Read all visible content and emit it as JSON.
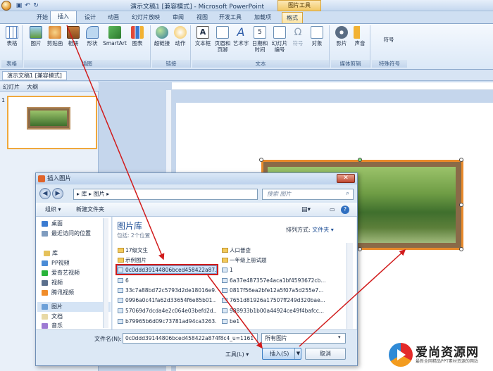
{
  "window": {
    "title": "演示文稿1 [兼容模式] - Microsoft PowerPoint",
    "contextual_tab_group": "图片工具"
  },
  "tabs": [
    "开始",
    "插入",
    "设计",
    "动画",
    "幻灯片放映",
    "审阅",
    "视图",
    "开发工具",
    "加载项",
    "格式"
  ],
  "ribbon": {
    "groups": [
      "表格",
      "插图",
      "链接",
      "文本",
      "媒体剪辑",
      "特殊符号"
    ],
    "buttons": [
      "表格",
      "图片",
      "剪贴画",
      "相册",
      "形状",
      "SmartArt",
      "图表",
      "超链接",
      "动作",
      "文本框",
      "页眉和页脚",
      "艺术字",
      "日期和时间",
      "幻灯片编号",
      "符号",
      "对象",
      "影片",
      "声音",
      "符号"
    ]
  },
  "document_tab": "演示文稿1 [兼容模式]",
  "left_pane": {
    "tabs": [
      "幻灯片",
      "大纲"
    ],
    "slide_number": "1"
  },
  "dialog": {
    "title": "插入图片",
    "address": "▸ 库 ▸ 图片 ▸",
    "search_placeholder": "搜索 图片",
    "toolbar": {
      "organize": "组织 ▾",
      "new_folder": "新建文件夹"
    },
    "nav": [
      "桌面",
      "最近访问的位置",
      "库",
      "PP视频",
      "爱奇艺视频",
      "视频",
      "腾讯视频",
      "图片",
      "文档",
      "音乐"
    ],
    "library_title": "图片库",
    "library_subtitle": "包括: 2个位置",
    "arrange_label": "排列方式:",
    "arrange_value": "文件夹 ▾",
    "files_left": [
      "17级文生",
      "示例图片",
      "0c0ddd39144806bced458422a87...",
      "6",
      "33c7a88bd72c5793d2de18016e9...",
      "0996a0c41fa62d33654f6e85b01...",
      "57069d7dcda4e2c064e03befd2d...",
      "b79965b6d09c73781ad94ca3263..."
    ],
    "files_right": [
      "人口普查",
      "一年级上册试题",
      "1",
      "6a37e487357e4aca1bf4593672cb...",
      "0817f56ea2bfe12a5f07a5d255e7...",
      "7651d81926a17507ff249d320bae...",
      "988933b1b00a44924ce49f4bafcc...",
      "be1"
    ],
    "footer": {
      "filename_label": "文件名(N):",
      "filename_value": "0c0ddd39144806bced458422a874f8c4_u=1161",
      "filetype": "所有图片",
      "tools": "工具(L) ▾",
      "insert": "插入(S)",
      "cancel": "取消"
    }
  },
  "watermark": {
    "title": "爱尚资源网",
    "subtitle": "最新全网精品PPT素材资源的网站"
  },
  "colors": {
    "accent_orange": "#e88a2b",
    "annotation_red": "#d11b1b",
    "ribbon_blue": "#dbe8f7"
  }
}
